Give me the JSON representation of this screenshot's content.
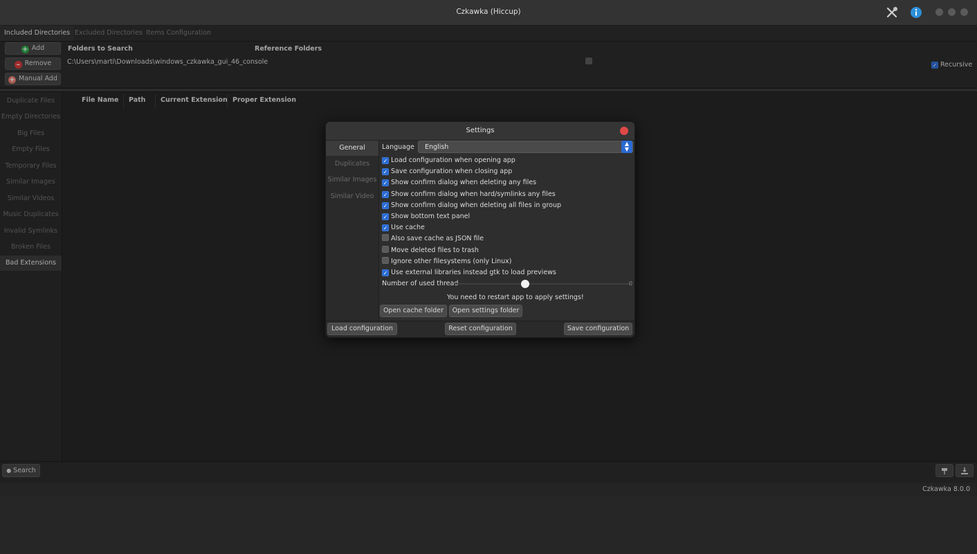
{
  "window": {
    "title": "Czkawka (Hiccup)"
  },
  "tabs": [
    "Included Directories",
    "Excluded Directories",
    "Items Configuration"
  ],
  "directories": {
    "add_label": "Add",
    "remove_label": "Remove",
    "manual_add_label": "Manual Add",
    "col_folders": "Folders to Search",
    "col_reference": "Reference Folders",
    "row_path": "C:\\Users\\marti\\Downloads\\windows_czkawka_gui_46_console",
    "recursive_label": "Recursive",
    "recursive_checked": true
  },
  "sidebar": {
    "items": [
      "Duplicate Files",
      "Empty Directories",
      "Big Files",
      "Empty Files",
      "Temporary Files",
      "Similar Images",
      "Similar Videos",
      "Music Duplicates",
      "Invalid Symlinks",
      "Broken Files",
      "Bad Extensions"
    ],
    "active": "Bad Extensions"
  },
  "results": {
    "columns": [
      "File Name",
      "Path",
      "Current Extension",
      "Proper Extension"
    ]
  },
  "bottom": {
    "search_label": "Search"
  },
  "status": {
    "version": "Czkawka 8.0.0"
  },
  "settings": {
    "title": "Settings",
    "nav": [
      "General",
      "Duplicates",
      "Similar Images",
      "Similar Video"
    ],
    "nav_active": "General",
    "language_label": "Language",
    "language_value": "English",
    "options": [
      {
        "label": "Load configuration when opening app",
        "checked": true
      },
      {
        "label": "Save configuration when closing app",
        "checked": true
      },
      {
        "label": "Show confirm dialog when deleting any files",
        "checked": true
      },
      {
        "label": "Show confirm dialog when hard/symlinks any files",
        "checked": true
      },
      {
        "label": "Show confirm dialog when deleting all files in group",
        "checked": true
      },
      {
        "label": "Show bottom text panel",
        "checked": true
      },
      {
        "label": "Use cache",
        "checked": true
      },
      {
        "label": "Also save cache as JSON file",
        "checked": false
      },
      {
        "label": "Move deleted files to trash",
        "checked": false
      },
      {
        "label": "Ignore other filesystems (only Linux)",
        "checked": false
      },
      {
        "label": "Use external libraries instead gtk to load previews",
        "checked": true
      }
    ],
    "threads_label": "Number of used thread",
    "threads_value": "0",
    "threads_fraction": 0.4,
    "restart_note": "You need to restart app to apply settings!",
    "open_cache_label": "Open cache folder",
    "open_settings_label": "Open settings folder",
    "load_config_label": "Load configuration",
    "reset_config_label": "Reset configuration",
    "save_config_label": "Save configuration"
  },
  "colors": {
    "accent": "#2a6ad2",
    "close": "#e04848",
    "window_bg": "#262626"
  },
  "icons": [
    "tools-icon",
    "info-icon",
    "add-icon",
    "remove-icon",
    "manual-add-icon",
    "search-icon",
    "pin-icon",
    "download-icon"
  ]
}
